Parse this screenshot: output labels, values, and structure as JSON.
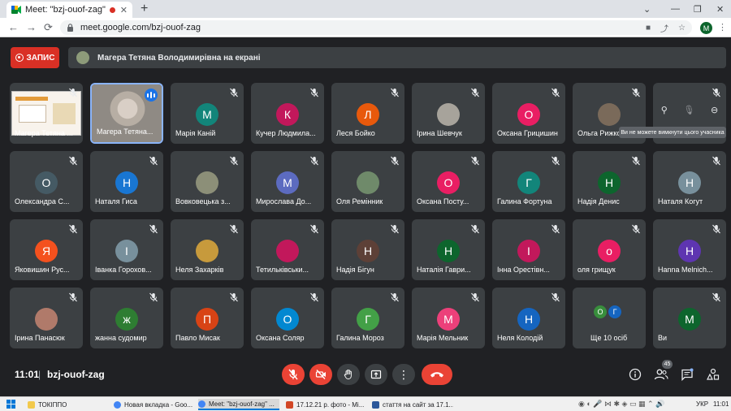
{
  "browser": {
    "tab_title": "Meet: \"bzj-ouof-zag\"",
    "tab_close": "✕",
    "new_tab": "+",
    "win_min": "⌄",
    "win_minimize": "—",
    "win_restore": "❐",
    "win_close": "✕",
    "url": "meet.google.com/bzj-ouof-zag",
    "profile_letter": "M"
  },
  "meet": {
    "record_label": "ЗАПИС",
    "presenting_text": "Магера Тетяна Володимирівна на екрані",
    "tooltip": "Ви не можете вимкнути цього учасника",
    "time": "11:01",
    "separator": "|",
    "meeting_code": "bzj-ouof-zag",
    "participants_count": "45",
    "more_label": "Ще 10 осіб",
    "colors": {
      "accent_red": "#ea4335",
      "speaking_blue": "#1a73e8",
      "tile_bg": "#3c4043"
    }
  },
  "tiles": {
    "r0": [
      {
        "name": "Магера Тетяна ...",
        "kind": "share"
      },
      {
        "name": "Магера Тетяна...",
        "kind": "speaker"
      },
      {
        "name": "Марія Каній",
        "initial": "М",
        "color": "#12857a"
      },
      {
        "name": "Кучер Людмила...",
        "initial": "К",
        "color": "#c2185b"
      },
      {
        "name": "Леся Бойко",
        "initial": "Л",
        "color": "#e8590c"
      },
      {
        "name": "Ірина Шевчук",
        "initial": "",
        "color": "#a7a39b"
      },
      {
        "name": "Оксана Грицишин",
        "initial": "О",
        "color": "#e91e63"
      },
      {
        "name": "Ольга Рижко",
        "initial": "",
        "color": "#7a6a5a"
      },
      {
        "name": "",
        "kind": "hover"
      }
    ],
    "r1": [
      {
        "name": "Олександра С...",
        "initial": "О",
        "color": "#455a64"
      },
      {
        "name": "Наталя Гиса",
        "initial": "Н",
        "color": "#1976d2"
      },
      {
        "name": "Вовковецька з...",
        "initial": "",
        "color": "#8c8f78"
      },
      {
        "name": "Мирослава До...",
        "initial": "М",
        "color": "#5c6bc0"
      },
      {
        "name": "Оля Ремінник",
        "initial": "",
        "color": "#6f8a6a"
      },
      {
        "name": "Оксана Посту...",
        "initial": "О",
        "color": "#e91e63"
      },
      {
        "name": "Галина Фортуна",
        "initial": "Г",
        "color": "#12857a"
      },
      {
        "name": "Надія Денис",
        "initial": "Н",
        "color": "#0d652d"
      },
      {
        "name": "Наталя Когут",
        "initial": "Н",
        "color": "#78909c"
      }
    ],
    "r2": [
      {
        "name": "Яковишин Рус...",
        "initial": "Я",
        "color": "#f4511e"
      },
      {
        "name": "Іванка Горохов...",
        "initial": "І",
        "color": "#78909c"
      },
      {
        "name": "Неля Захарків",
        "initial": "",
        "color": "#c79a3c"
      },
      {
        "name": "Тетильківськи...",
        "initial": "",
        "color": "#c2185b"
      },
      {
        "name": "Надія Бігун",
        "initial": "Н",
        "color": "#5d4037"
      },
      {
        "name": "Наталія Гаври...",
        "initial": "Н",
        "color": "#0d652d"
      },
      {
        "name": "Інна Орестівн...",
        "initial": "І",
        "color": "#c2185b"
      },
      {
        "name": "оля грищук",
        "initial": "о",
        "color": "#e91e63"
      },
      {
        "name": "Hanna Melnich...",
        "initial": "H",
        "color": "#5e35b1"
      }
    ],
    "r3": [
      {
        "name": "Ірина Панасюк",
        "initial": "",
        "color": "#b07a6a"
      },
      {
        "name": "жанна судомир",
        "initial": "ж",
        "color": "#2e7d32"
      },
      {
        "name": "Павло Мисак",
        "initial": "П",
        "color": "#d84315"
      },
      {
        "name": "Оксана Соляр",
        "initial": "О",
        "color": "#0288d1"
      },
      {
        "name": "Галина Мороз",
        "initial": "Г",
        "color": "#43a047"
      },
      {
        "name": "Марія Мельник",
        "initial": "М",
        "color": "#ec407a"
      },
      {
        "name": "Неля Колодій",
        "initial": "Н",
        "color": "#1565c0"
      },
      {
        "name": "",
        "kind": "more",
        "a": "О",
        "b": "Г"
      },
      {
        "name": "Ви",
        "initial": "М",
        "color": "#0d652d"
      }
    ]
  },
  "taskbar": {
    "items": [
      {
        "label": "ТОКІППО",
        "color": "#f2c94c"
      },
      {
        "label": "Новая вкладка - Goo...",
        "color": "#4285f4"
      },
      {
        "label": "Meet: \"bzj-ouof-zag\" ...",
        "color": "#4285f4"
      },
      {
        "label": "17.12.21 р. фото - Mi...",
        "color": "#d24726"
      },
      {
        "label": "стаття на сайт за 17.1...",
        "color": "#2b579a"
      }
    ],
    "lang": "УКР",
    "clock": "11:01"
  }
}
